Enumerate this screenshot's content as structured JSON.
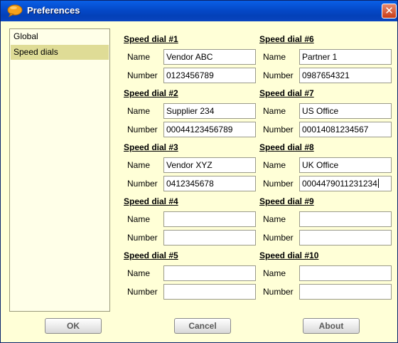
{
  "window": {
    "title": "Preferences",
    "close_label": "✕"
  },
  "sidebar": {
    "items": [
      {
        "label": "Global"
      },
      {
        "label": "Speed dials"
      }
    ]
  },
  "speed_dials": {
    "name_label": "Name",
    "number_label": "Number",
    "dials": [
      {
        "title": "Speed dial #1",
        "name": "Vendor ABC",
        "number": "0123456789"
      },
      {
        "title": "Speed dial #2",
        "name": "Supplier 234",
        "number": "00044123456789"
      },
      {
        "title": "Speed dial #3",
        "name": "Vendor XYZ",
        "number": "0412345678"
      },
      {
        "title": "Speed dial #4",
        "name": "",
        "number": ""
      },
      {
        "title": "Speed dial #5",
        "name": "",
        "number": ""
      },
      {
        "title": "Speed dial #6",
        "name": "Partner 1",
        "number": "0987654321"
      },
      {
        "title": "Speed dial #7",
        "name": "US Office",
        "number": "00014081234567"
      },
      {
        "title": "Speed dial #8",
        "name": "UK Office",
        "number": "0004479011231234"
      },
      {
        "title": "Speed dial #9",
        "name": "",
        "number": ""
      },
      {
        "title": "Speed dial #10",
        "name": "",
        "number": ""
      }
    ]
  },
  "buttons": {
    "ok": "OK",
    "cancel": "Cancel",
    "about": "About"
  },
  "colors": {
    "window_bg": "#ffffd7",
    "selected_item": "#dfdc96",
    "titlebar": "#0449c8"
  },
  "icons": {
    "app": "chat-bubble-icon",
    "close": "close-icon"
  }
}
